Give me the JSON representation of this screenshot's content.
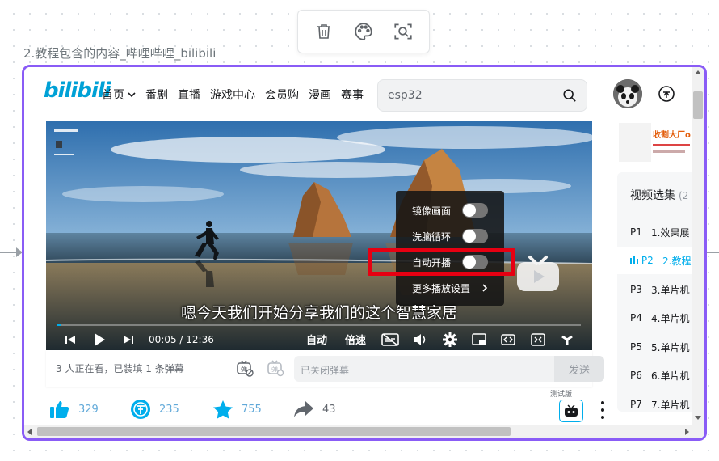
{
  "toolbar": {
    "delete_icon": "trash-icon",
    "palette_icon": "palette-icon",
    "zoom_icon": "zoom-focus-icon"
  },
  "frame_caption": "2.教程包含的内容_哔哩哔哩_bilibili",
  "header": {
    "logo": "bilibili",
    "nav": [
      "首页",
      "番剧",
      "直播",
      "游戏中心",
      "会员购",
      "漫画",
      "赛事"
    ],
    "search_value": "esp32"
  },
  "player": {
    "subtitle": "嗯今天我们开始分享我们的这个智慧家居",
    "time_current": "00:05",
    "time_total": "12:36",
    "progress_fraction": 0.007,
    "auto_label": "自动",
    "speed_label": "倍速",
    "settings": {
      "mirror": "镜像画面",
      "loop": "洗脑循环",
      "autoplay": "自动开播",
      "more": "更多播放设置"
    }
  },
  "danmaku": {
    "viewers": "3 人正在看，已装填 1 条弹幕",
    "input_placeholder": "已关闭弹幕",
    "send": "发送"
  },
  "actions": {
    "like": "329",
    "coin": "235",
    "favorite": "755",
    "share": "43",
    "test_badge": "测试版"
  },
  "playlist": {
    "title": "视频选集",
    "count": "(2",
    "items": [
      {
        "p": "P1",
        "title": "1.效果展"
      },
      {
        "p": "P2",
        "title": "2.教程"
      },
      {
        "p": "P3",
        "title": "3.单片机"
      },
      {
        "p": "P4",
        "title": "4.单片机"
      },
      {
        "p": "P5",
        "title": "5.单片机"
      },
      {
        "p": "P6",
        "title": "6.单片机"
      },
      {
        "p": "P7",
        "title": "7.单片机"
      }
    ]
  },
  "colors": {
    "frame_border": "#8a5cf6",
    "brand": "#00a1d6",
    "accent": "#00aeec",
    "highlight": "#e60012"
  }
}
